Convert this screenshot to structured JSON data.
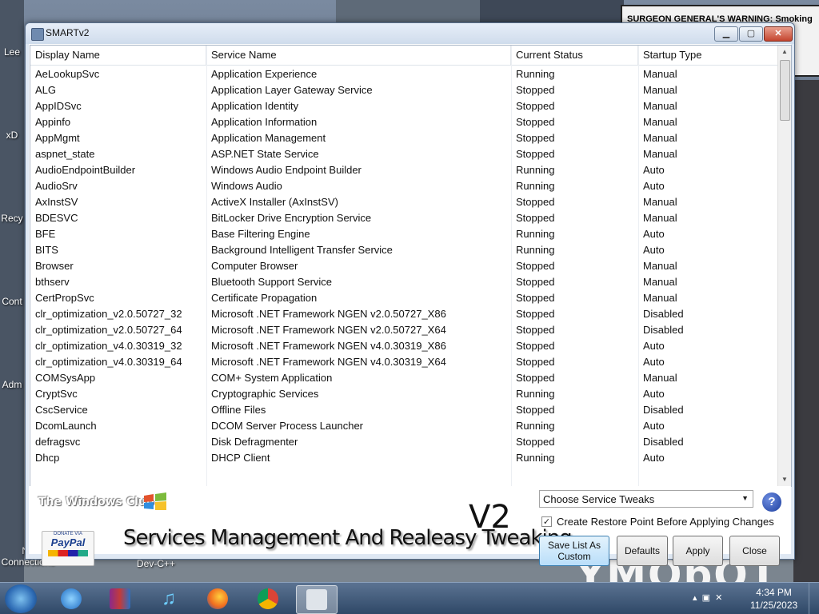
{
  "window": {
    "title": "SMARTv2"
  },
  "columns": [
    "Display Name",
    "Service Name",
    "Current Status",
    "Startup Type"
  ],
  "rows": [
    [
      "AeLookupSvc",
      "Application Experience",
      "Running",
      "Manual"
    ],
    [
      "ALG",
      "Application Layer Gateway Service",
      "Stopped",
      "Manual"
    ],
    [
      "AppIDSvc",
      "Application Identity",
      "Stopped",
      "Manual"
    ],
    [
      "Appinfo",
      "Application Information",
      "Stopped",
      "Manual"
    ],
    [
      "AppMgmt",
      "Application Management",
      "Stopped",
      "Manual"
    ],
    [
      "aspnet_state",
      "ASP.NET State Service",
      "Stopped",
      "Manual"
    ],
    [
      "AudioEndpointBuilder",
      "Windows Audio Endpoint Builder",
      "Running",
      "Auto"
    ],
    [
      "AudioSrv",
      "Windows Audio",
      "Running",
      "Auto"
    ],
    [
      "AxInstSV",
      "ActiveX Installer (AxInstSV)",
      "Stopped",
      "Manual"
    ],
    [
      "BDESVC",
      "BitLocker Drive Encryption Service",
      "Stopped",
      "Manual"
    ],
    [
      "BFE",
      "Base Filtering Engine",
      "Running",
      "Auto"
    ],
    [
      "BITS",
      "Background Intelligent Transfer Service",
      "Running",
      "Auto"
    ],
    [
      "Browser",
      "Computer Browser",
      "Stopped",
      "Manual"
    ],
    [
      "bthserv",
      "Bluetooth Support Service",
      "Stopped",
      "Manual"
    ],
    [
      "CertPropSvc",
      "Certificate Propagation",
      "Stopped",
      "Manual"
    ],
    [
      "clr_optimization_v2.0.50727_32",
      "Microsoft .NET Framework NGEN v2.0.50727_X86",
      "Stopped",
      "Disabled"
    ],
    [
      "clr_optimization_v2.0.50727_64",
      "Microsoft .NET Framework NGEN v2.0.50727_X64",
      "Stopped",
      "Disabled"
    ],
    [
      "clr_optimization_v4.0.30319_32",
      "Microsoft .NET Framework NGEN v4.0.30319_X86",
      "Stopped",
      "Auto"
    ],
    [
      "clr_optimization_v4.0.30319_64",
      "Microsoft .NET Framework NGEN v4.0.30319_X64",
      "Stopped",
      "Auto"
    ],
    [
      "COMSysApp",
      "COM+ System Application",
      "Stopped",
      "Manual"
    ],
    [
      "CryptSvc",
      "Cryptographic Services",
      "Running",
      "Auto"
    ],
    [
      "CscService",
      "Offline Files",
      "Stopped",
      "Disabled"
    ],
    [
      "DcomLaunch",
      "DCOM Server Process Launcher",
      "Running",
      "Auto"
    ],
    [
      "defragsvc",
      "Disk Defragmenter",
      "Stopped",
      "Disabled"
    ],
    [
      "Dhcp",
      "DHCP Client",
      "Running",
      "Auto"
    ]
  ],
  "branding": {
    "twc": "The Windows Club",
    "paypal_top": "DONATE VIA",
    "paypal_brand": "PayPal",
    "v2": "V2",
    "title": "Services Management And Realeasy Tweaking"
  },
  "controls": {
    "tweaks_combo": "Choose Service Tweaks",
    "restore_point_label": "Create Restore Point Before Applying Changes",
    "restore_point_checked": true,
    "save_list_line1": "Save List As",
    "save_list_line2": "Custom",
    "defaults": "Defaults",
    "apply": "Apply",
    "close": "Close",
    "help": "?"
  },
  "desktop": {
    "warning": "SURGEON GENERAL'S WARNING: Smoking",
    "icons": [
      "Lee",
      "xD",
      "Recy",
      "Cont",
      "Adm",
      "Ne\nConnections",
      "Dev-C++"
    ],
    "wallpaper_word": "YMObOT"
  },
  "taskbar": {
    "apps": [
      "internet-explorer",
      "winrar",
      "itunes",
      "firefox",
      "chrome",
      "smart"
    ],
    "time": "4:34 PM",
    "date": "11/25/2023"
  }
}
